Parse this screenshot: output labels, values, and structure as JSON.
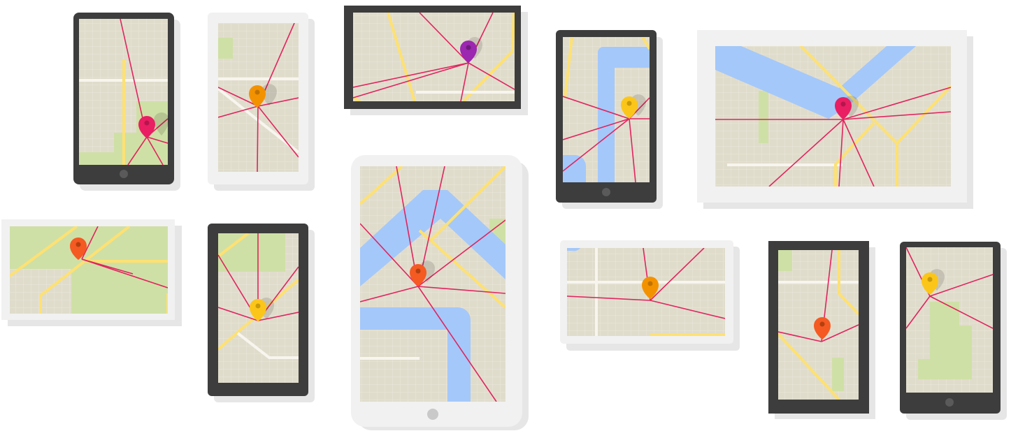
{
  "title": "",
  "colors": {
    "device_dark": "#3d3d3d",
    "device_light": "#f1f1f1",
    "device_shadow": "#e6e6e6",
    "map_base": "#e0dccc",
    "map_grid": "#ece8dc",
    "park": "#cfe0a6",
    "water": "#a4c8fa",
    "road_yellow": "#fde172",
    "road_white": "#f7f5ee",
    "route_line": "#e0245e",
    "home_button": "#c4c4c4",
    "home_button_light": "#cfcfcf"
  },
  "devices": [
    {
      "name": "phone-dark-1",
      "style": "dark",
      "pin": "pink"
    },
    {
      "name": "phone-light-1",
      "style": "light",
      "pin": "orange"
    },
    {
      "name": "tablet-dark-landscape-1",
      "style": "dark",
      "pin": "purple"
    },
    {
      "name": "phone-dark-2",
      "style": "dark",
      "pin": "yellow"
    },
    {
      "name": "tablet-light-landscape-1",
      "style": "light",
      "pin": "pink"
    },
    {
      "name": "tablet-light-landscape-2",
      "style": "light",
      "pin": "orange-red"
    },
    {
      "name": "phone-dark-3",
      "style": "dark",
      "pin": "yellow"
    },
    {
      "name": "tablet-light-portrait",
      "style": "light",
      "pin": "orange-red"
    },
    {
      "name": "tablet-light-landscape-3",
      "style": "light",
      "pin": "orange"
    },
    {
      "name": "phone-dark-4",
      "style": "dark",
      "pin": "orange-red"
    },
    {
      "name": "phone-dark-5",
      "style": "dark",
      "pin": "yellow"
    }
  ],
  "pin_colors": {
    "pink": "#e91e63",
    "orange": "#f39200",
    "purple": "#9c27b0",
    "yellow": "#fbc619",
    "orange-red": "#f45a22"
  }
}
